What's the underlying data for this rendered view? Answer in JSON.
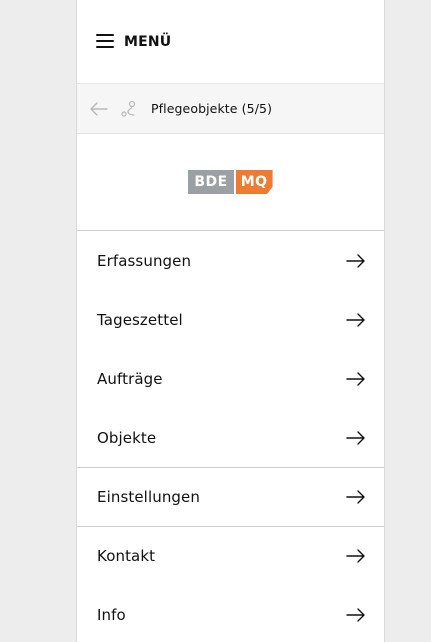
{
  "menu": {
    "label": "MENÜ"
  },
  "subbar": {
    "title": "Pflegeobjekte (5/5)"
  },
  "logo": {
    "left": "BDE",
    "right": "MQ",
    "colors": {
      "left_bg": "#9aa0a3",
      "right_bg": "#ef7a32"
    }
  },
  "nav": {
    "items": [
      {
        "label": "Erfassungen"
      },
      {
        "label": "Tageszettel"
      },
      {
        "label": "Aufträge"
      },
      {
        "label": "Objekte"
      },
      {
        "label": "Einstellungen"
      },
      {
        "label": "Kontakt"
      },
      {
        "label": "Info"
      }
    ]
  },
  "icons": {
    "menu": "hamburger-icon",
    "back": "arrow-left-icon",
    "route": "route-icon",
    "nav_arrow": "arrow-right-icon"
  }
}
